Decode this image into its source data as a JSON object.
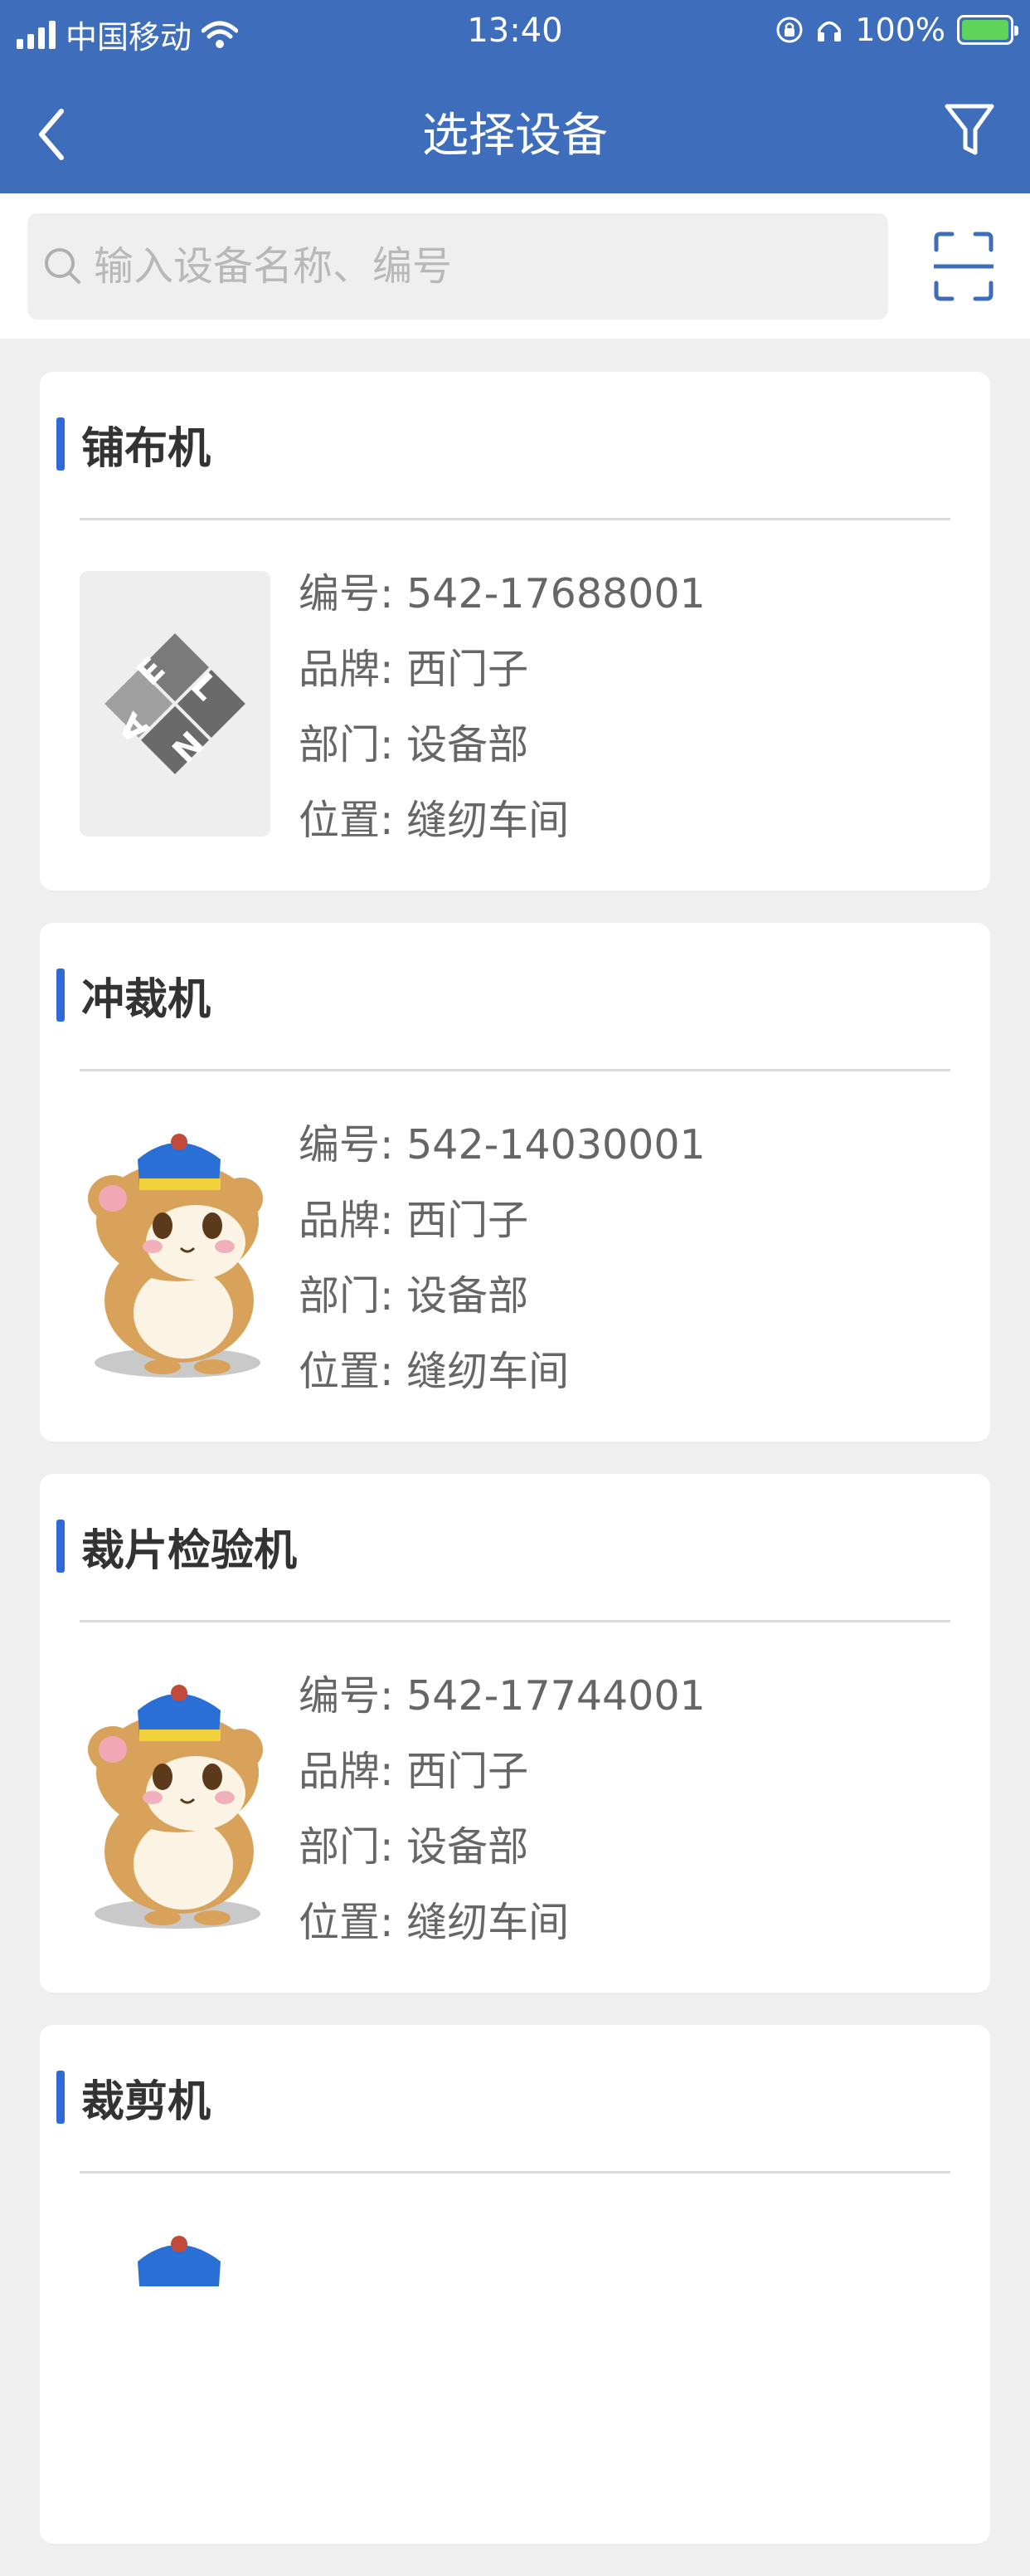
{
  "status_bar": {
    "carrier": "中国移动",
    "time": "13:40",
    "battery_percent": "100%"
  },
  "navbar": {
    "title": "选择设备"
  },
  "search": {
    "placeholder": "输入设备名称、编号"
  },
  "labels": {
    "code": "编号:",
    "brand": "品牌:",
    "department": "部门:",
    "location": "位置:"
  },
  "devices": [
    {
      "name": "铺布机",
      "code": "542-17688001",
      "brand": "西门子",
      "department": "设备部",
      "location": "缝纫车间",
      "image": "elna-logo"
    },
    {
      "name": "冲裁机",
      "code": "542-14030001",
      "brand": "西门子",
      "department": "设备部",
      "location": "缝纫车间",
      "image": "hamster-cartoon"
    },
    {
      "name": "裁片检验机",
      "code": "542-17744001",
      "brand": "西门子",
      "department": "设备部",
      "location": "缝纫车间",
      "image": "hamster-cartoon"
    },
    {
      "name": "裁剪机",
      "code": "",
      "brand": "",
      "department": "",
      "location": "",
      "image": "hamster-cartoon"
    }
  ],
  "colors": {
    "header": "#3d6dbb",
    "accent": "#2f6ad8",
    "background": "#efeff0"
  }
}
